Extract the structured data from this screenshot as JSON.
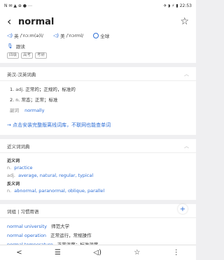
{
  "status": {
    "icons": "N ✉ ▲ ⊕ ● ⋯",
    "signal": "✈ ◗ ⚡ ▮",
    "time": "22:53"
  },
  "header": {
    "word": "normal",
    "phonetic_uk_label": "英",
    "phonetic_uk": "/ˈnɔːm(ə)l/",
    "phonetic_us_label": "美",
    "phonetic_us": "/ˈnɔrml/",
    "global_label": "全球",
    "read_label": "跟读",
    "tags": [
      "四级",
      "高考",
      "考研"
    ]
  },
  "dict": {
    "title": "英汉-汉英词典",
    "defs": [
      {
        "num": "1.",
        "pos": "adj.",
        "text": "正常的；正规的，标准的"
      },
      {
        "num": "2.",
        "pos": "n.",
        "text": "常态；正常；标准"
      }
    ],
    "adv_label": "副词",
    "adv_word": "normally",
    "promo": "→ 点击安装完整版离线词库，不联网也能查单词"
  },
  "synonyms": {
    "title": "近义词词典",
    "syn_label": "近义词",
    "syn_rows": [
      {
        "pos": "n.",
        "words": "practice"
      },
      {
        "pos": "adj.",
        "words": "average, natural, regular, typical"
      }
    ],
    "ant_label": "反义词",
    "ant_rows": [
      {
        "pos": "n.",
        "words": "abnormal, paranormal, oblique, parallel"
      }
    ]
  },
  "phrases": {
    "title": "词组 | 习惯用语",
    "rows": [
      {
        "en": "normal university",
        "zh": "师范大学"
      },
      {
        "en": "normal operation",
        "zh": "正常运行，常规操作"
      },
      {
        "en": "normal temperature",
        "zh": "正常温度；标准温度"
      }
    ]
  },
  "fab_label": "+",
  "bottom": {
    "back": "<",
    "list": "☰",
    "sound": "◁)",
    "fav": "☆",
    "more": "⋮"
  }
}
